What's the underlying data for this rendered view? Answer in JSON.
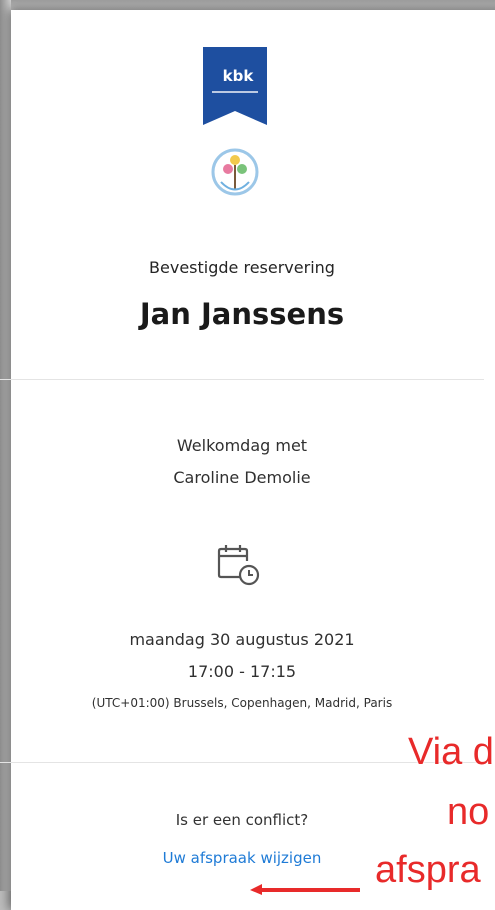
{
  "confirmation": {
    "status": "Bevestigde reservering",
    "customer_name": "Jan Janssens"
  },
  "appointment": {
    "service_line1": "Welkomdag met",
    "service_line2": "Caroline Demolie",
    "date": "maandag 30 augustus 2021",
    "time": "17:00 - 17:15",
    "timezone": "(UTC+01:00) Brussels, Copenhagen, Madrid, Paris"
  },
  "footer": {
    "conflict_text": "Is er een conflict?",
    "change_link": "Uw afspraak wijzigen"
  },
  "annotation": {
    "line1": "Via d",
    "line2": "no",
    "line3": "afspra"
  },
  "logo": {
    "text": "kbk"
  },
  "colors": {
    "link": "#1f7bd6",
    "annotation_red": "#e82a2a",
    "logo_blue": "#1e4fa0"
  }
}
